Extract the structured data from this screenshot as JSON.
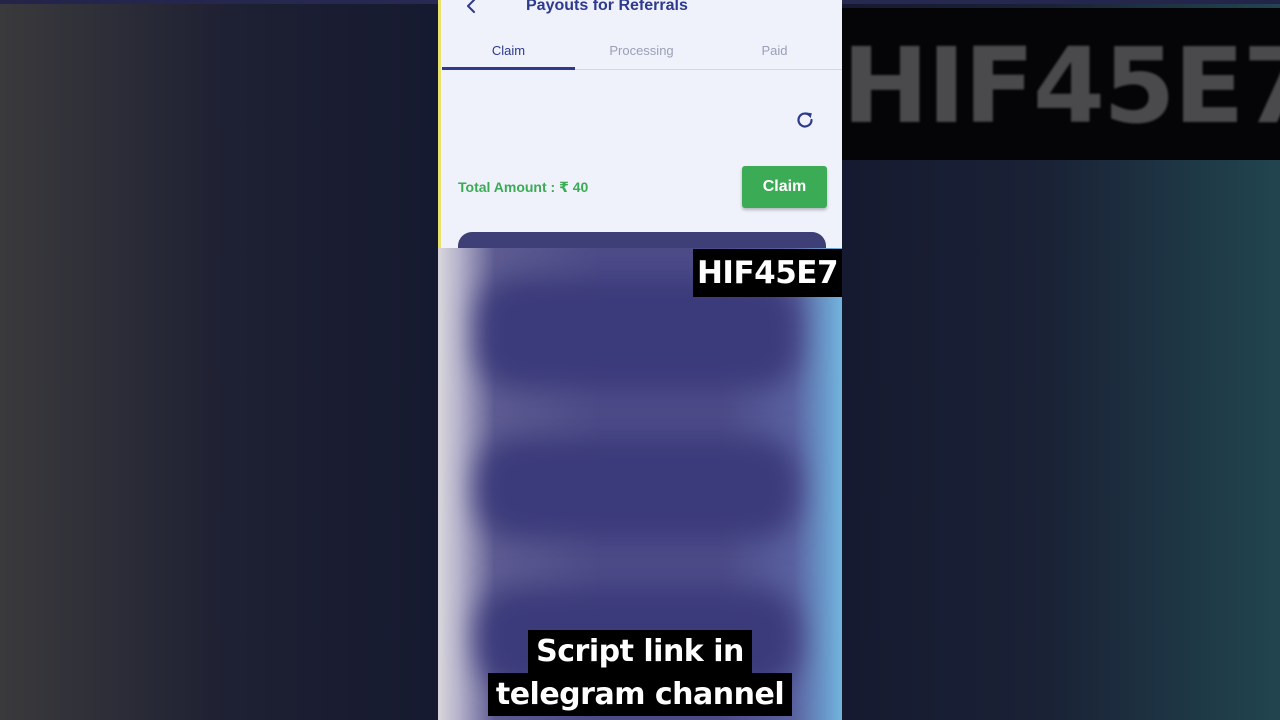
{
  "app": {
    "title": "Payouts for Referrals",
    "back_icon": "chevron-left-icon"
  },
  "tabs": [
    {
      "label": "Claim",
      "active": true
    },
    {
      "label": "Processing",
      "active": false
    },
    {
      "label": "Paid",
      "active": false
    }
  ],
  "claim_panel": {
    "refresh_icon": "refresh-icon",
    "total_amount_text": "Total Amount : ₹ 40",
    "claim_button_label": "Claim"
  },
  "overlay": {
    "code_badge": "HIF45E7",
    "background_banner": "HIF45E7",
    "caption_lines": [
      "Script link in",
      "telegram channel"
    ]
  },
  "colors": {
    "primary": "#2e3a8c",
    "success": "#3cab56",
    "card": "#3e3f76",
    "screen_bg": "#eff1fb"
  }
}
